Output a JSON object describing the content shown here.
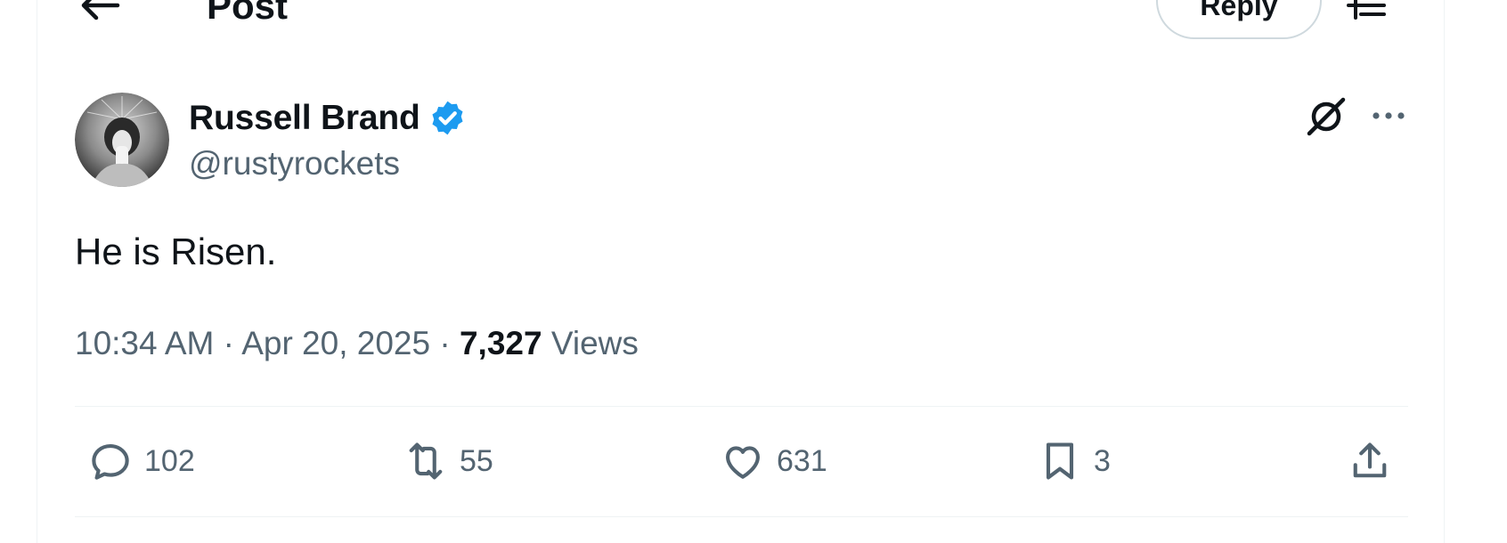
{
  "header": {
    "title": "Post",
    "reply_button": "Reply"
  },
  "post": {
    "author": {
      "display_name": "Russell Brand",
      "handle": "@rustyrockets",
      "verified": true
    },
    "text": "He is Risen.",
    "time": "10:34 AM",
    "separator": "·",
    "date": "Apr 20, 2025",
    "views_count": "7,327",
    "views_label": "Views"
  },
  "actions": {
    "replies": "102",
    "reposts": "55",
    "likes": "631",
    "bookmarks": "3"
  },
  "colors": {
    "verified": "#1d9bf0",
    "text_primary": "#0f1419",
    "text_secondary": "#536471",
    "border": "#eff3f4"
  },
  "icons": [
    "back-arrow-icon",
    "settings-sliders-icon",
    "verified-badge-icon",
    "grok-icon",
    "more-icon",
    "reply-icon",
    "repost-icon",
    "like-icon",
    "bookmark-icon",
    "share-icon"
  ]
}
